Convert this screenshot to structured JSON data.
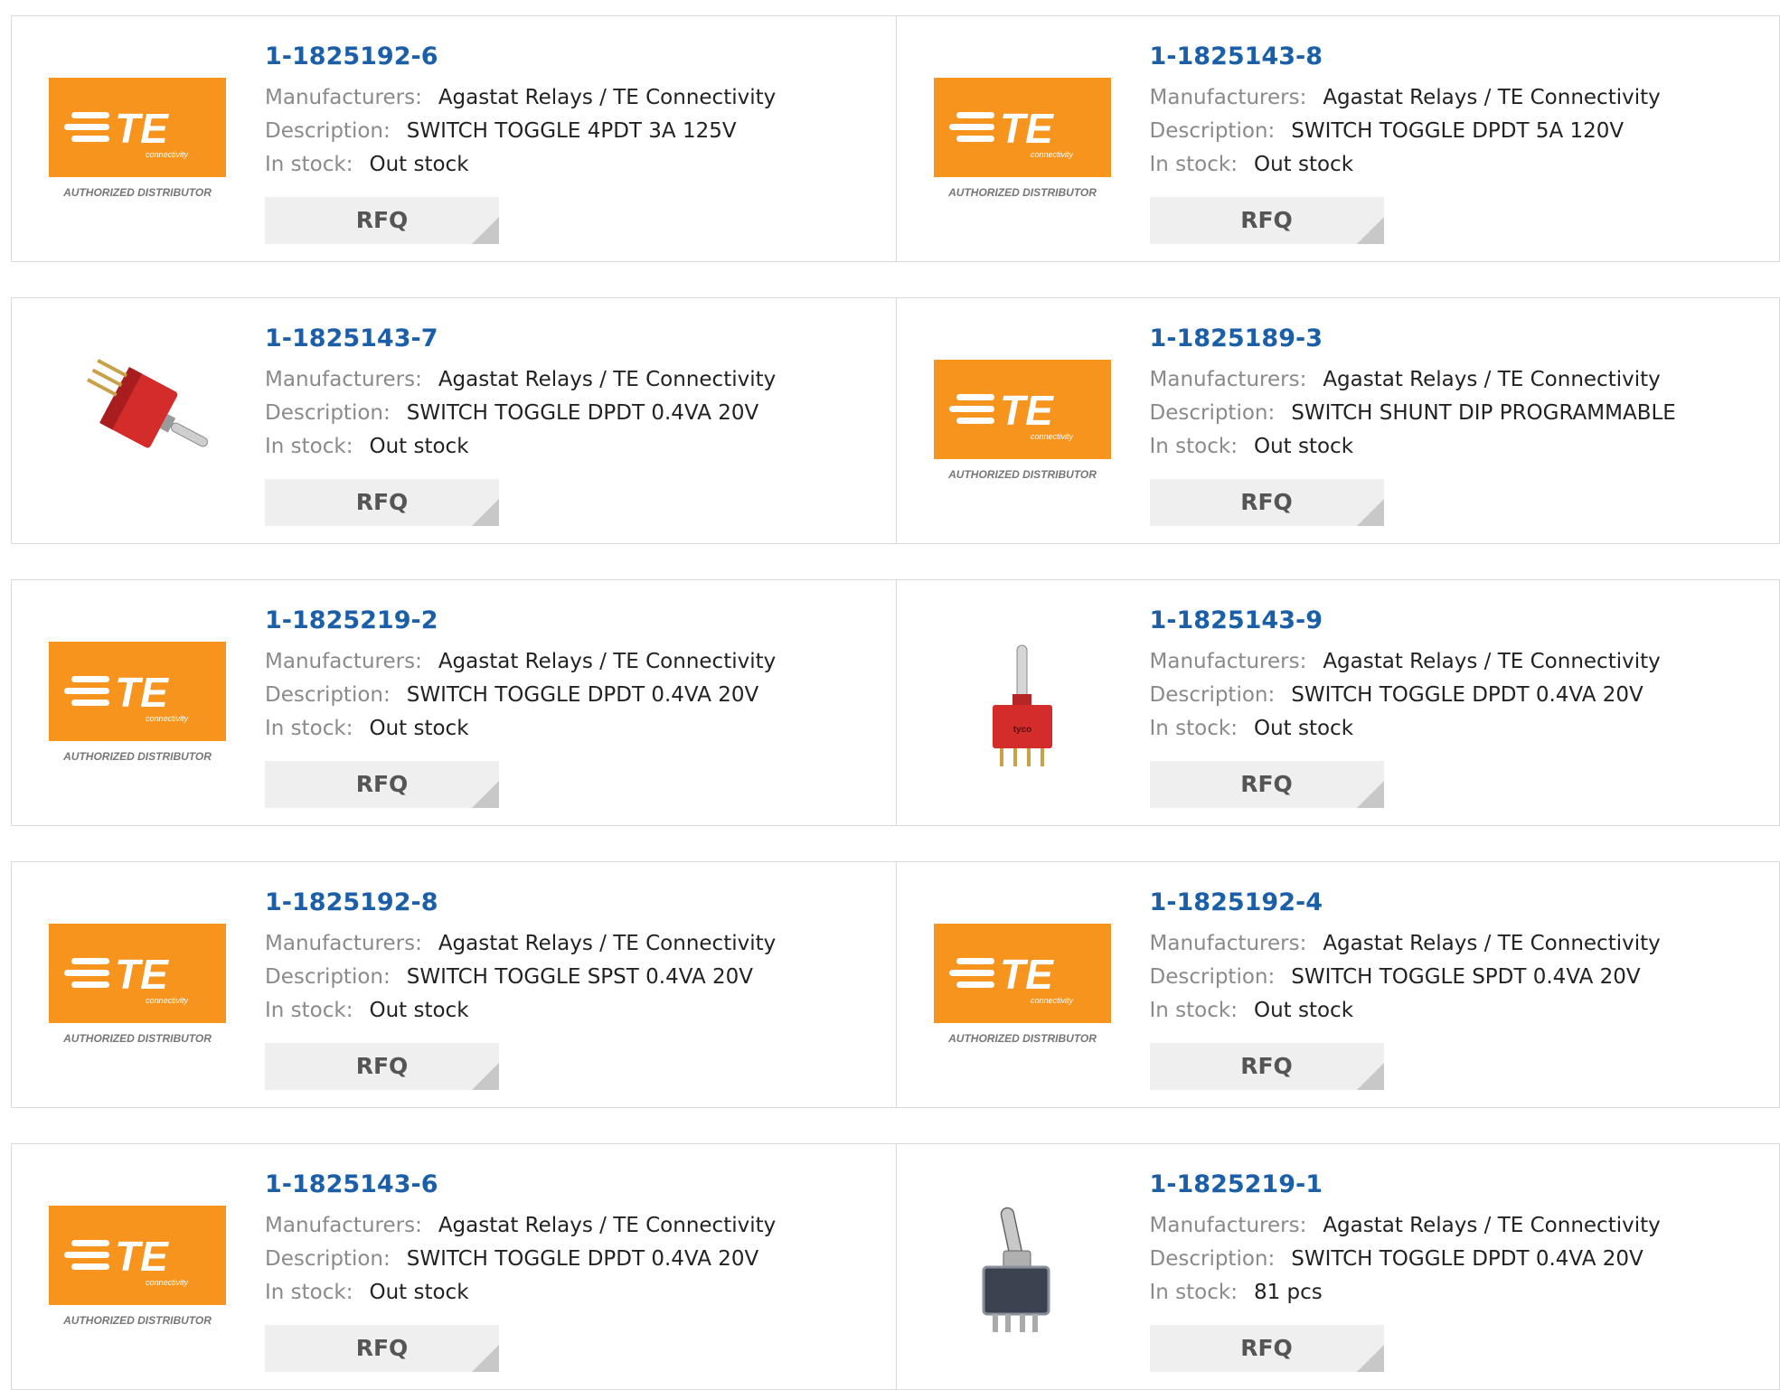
{
  "labels": {
    "manufacturers": "Manufacturers:",
    "description": "Description:",
    "in_stock": "In stock:",
    "rfq": "RFQ"
  },
  "logo": {
    "brand": "TE",
    "sub": "connectivity",
    "tagline": "AUTHORIZED DISTRIBUTOR",
    "color": "#f7941d"
  },
  "products": [
    {
      "part": "1-1825192-6",
      "manufacturer": "Agastat Relays / TE Connectivity",
      "description": "SWITCH TOGGLE 4PDT 3A 125V",
      "stock": "Out stock",
      "image": "te-logo"
    },
    {
      "part": "1-1825143-8",
      "manufacturer": "Agastat Relays / TE Connectivity",
      "description": "SWITCH TOGGLE DPDT 5A 120V",
      "stock": "Out stock",
      "image": "te-logo"
    },
    {
      "part": "1-1825143-7",
      "manufacturer": "Agastat Relays / TE Connectivity",
      "description": "SWITCH TOGGLE DPDT 0.4VA 20V",
      "stock": "Out stock",
      "image": "red-toggle-switch-angled"
    },
    {
      "part": "1-1825189-3",
      "manufacturer": "Agastat Relays / TE Connectivity",
      "description": "SWITCH SHUNT DIP PROGRAMMABLE",
      "stock": "Out stock",
      "image": "te-logo"
    },
    {
      "part": "1-1825219-2",
      "manufacturer": "Agastat Relays / TE Connectivity",
      "description": "SWITCH TOGGLE DPDT 0.4VA 20V",
      "stock": "Out stock",
      "image": "te-logo"
    },
    {
      "part": "1-1825143-9",
      "manufacturer": "Agastat Relays / TE Connectivity",
      "description": "SWITCH TOGGLE DPDT 0.4VA 20V",
      "stock": "Out stock",
      "image": "red-toggle-switch-upright"
    },
    {
      "part": "1-1825192-8",
      "manufacturer": "Agastat Relays / TE Connectivity",
      "description": "SWITCH TOGGLE SPST 0.4VA 20V",
      "stock": "Out stock",
      "image": "te-logo"
    },
    {
      "part": "1-1825192-4",
      "manufacturer": "Agastat Relays / TE Connectivity",
      "description": "SWITCH TOGGLE SPDT 0.4VA 20V",
      "stock": "Out stock",
      "image": "te-logo"
    },
    {
      "part": "1-1825143-6",
      "manufacturer": "Agastat Relays / TE Connectivity",
      "description": "SWITCH TOGGLE DPDT 0.4VA 20V",
      "stock": "Out stock",
      "image": "te-logo"
    },
    {
      "part": "1-1825219-1",
      "manufacturer": "Agastat Relays / TE Connectivity",
      "description": "SWITCH TOGGLE DPDT 0.4VA 20V",
      "stock": "81 pcs",
      "image": "gray-toggle-switch"
    }
  ]
}
